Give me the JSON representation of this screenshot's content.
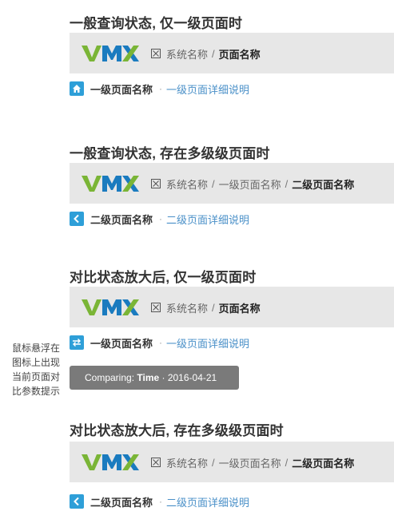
{
  "brand": {
    "logo_text": "VMX",
    "accent": "#2e9fd8",
    "logo_green": "#7ab536",
    "logo_blue": "#1a7bbf"
  },
  "sections": [
    {
      "heading": "一般查询状态, 仅一级页面时",
      "crumbs": {
        "system": "系统名称",
        "sep1": "/",
        "current": "页面名称"
      },
      "sub": {
        "icon": "home-icon",
        "name": "一级页面名称",
        "dot": "·",
        "desc": "一级页面详细说明"
      }
    },
    {
      "heading": "一般查询状态, 存在多级级页面时",
      "crumbs": {
        "system": "系统名称",
        "sep1": "/",
        "level1": "一级页面名称",
        "sep2": "/",
        "current": "二级页面名称"
      },
      "sub": {
        "icon": "back-arrow-icon",
        "name": "二级页面名称",
        "dot": "·",
        "desc": "二级页面详细说明"
      }
    },
    {
      "heading": "对比状态放大后, 仅一级页面时",
      "crumbs": {
        "system": "系统名称",
        "sep1": "/",
        "current": "页面名称"
      },
      "sub": {
        "icon": "compare-swap-icon",
        "name": "一级页面名称",
        "dot": "·",
        "desc": "一级页面详细说明"
      }
    },
    {
      "heading": "对比状态放大后, 存在多级级页面时",
      "crumbs": {
        "system": "系统名称",
        "sep1": "/",
        "level1": "一级页面名称",
        "sep2": "/",
        "current": "二级页面名称"
      },
      "sub": {
        "icon": "back-arrow-icon",
        "name": "二级页面名称",
        "dot": "·",
        "desc": "二级页面详细说明"
      }
    }
  ],
  "side_note": "鼠标悬浮在图标上出现当前页面对比参数提示",
  "tooltip": {
    "prefix": "Comparing: ",
    "key": "Time",
    "rest": " · 2016-04-21"
  }
}
